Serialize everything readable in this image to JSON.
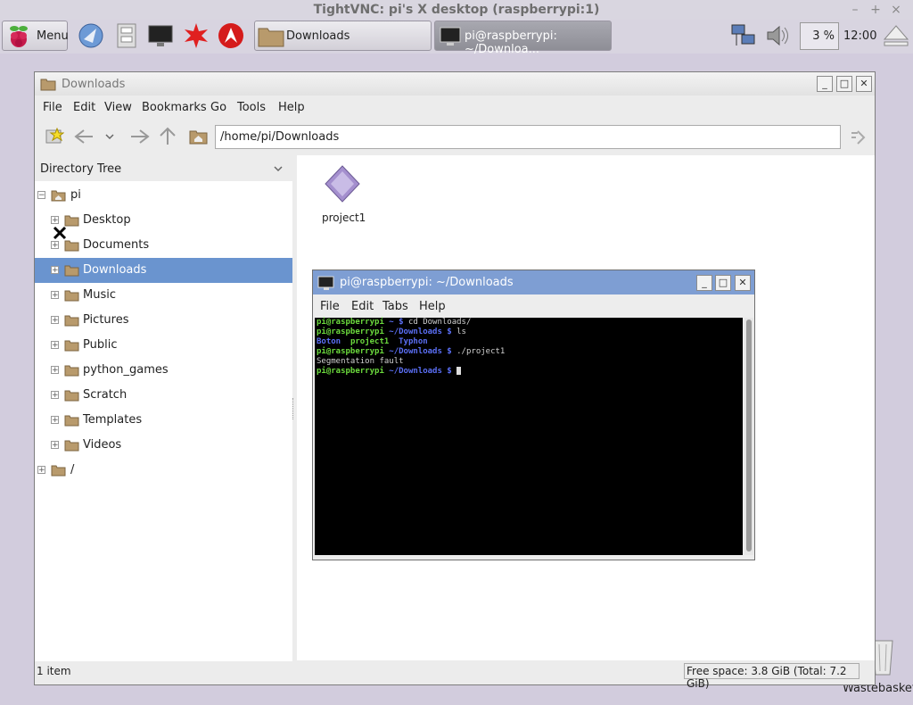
{
  "vnc": {
    "title": "TightVNC: pi's X desktop (raspberrypi:1)",
    "controls": [
      "–",
      "+",
      "×"
    ]
  },
  "taskbar": {
    "menu_label": "Menu",
    "tasks": [
      {
        "label": "Downloads"
      },
      {
        "label": "pi@raspberrypi: ~/Downloa..."
      }
    ],
    "cpu": "3 %",
    "clock": "12:00"
  },
  "file_manager": {
    "title": "Downloads",
    "menu": [
      "File",
      "Edit",
      "View",
      "Bookmarks",
      "Go",
      "Tools",
      "Help"
    ],
    "path": "/home/pi/Downloads",
    "sidebar_header": "Directory Tree",
    "tree_root": "pi",
    "tree_items": [
      "Desktop",
      "Documents",
      "Downloads",
      "Music",
      "Pictures",
      "Public",
      "python_games",
      "Scratch",
      "Templates",
      "Videos"
    ],
    "tree_root2": "/",
    "files": [
      {
        "name": "project1"
      }
    ],
    "status_left": "1 item",
    "status_right": "Free space: 3.8 GiB (Total: 7.2 GiB)"
  },
  "terminal": {
    "title": "pi@raspberrypi: ~/Downloads",
    "menu": [
      "File",
      "Edit",
      "Tabs",
      "Help"
    ],
    "lines": {
      "l1_prompt": "pi@raspberrypi",
      "l1_path": " ~ $ ",
      "l1_cmd": "cd Downloads/",
      "l2_prompt": "pi@raspberrypi",
      "l2_path": " ~/Downloads $ ",
      "l2_cmd": "ls",
      "l3_a": "Boton",
      "l3_b": "project1",
      "l3_c": "Typhon",
      "l4_prompt": "pi@raspberrypi",
      "l4_path": " ~/Downloads $ ",
      "l4_cmd": "./project1",
      "l5": "Segmentation fault",
      "l6_prompt": "pi@raspberrypi",
      "l6_path": " ~/Downloads $ "
    }
  },
  "desktop": {
    "wastebasket": "Wastebasket"
  },
  "colors": {
    "selection": "#6a94cf",
    "terminal_title": "#7e9ed3",
    "prompt_green": "#6cda3d",
    "dir_blue": "#5b6ff5"
  }
}
